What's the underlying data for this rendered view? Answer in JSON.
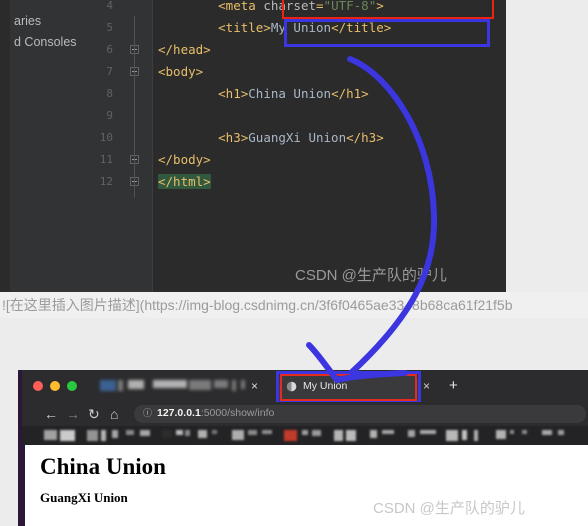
{
  "ide": {
    "sidebar": {
      "items": [
        {
          "label": "aries"
        },
        {
          "label": "d Consoles"
        }
      ]
    },
    "editor": {
      "lines": [
        {
          "number": "4",
          "indent": 8,
          "tokens": [
            {
              "text": "<meta",
              "cls": "tag"
            },
            {
              "text": " charset",
              "cls": "attr"
            },
            {
              "text": "=",
              "cls": "tag"
            },
            {
              "text": "\"UTF-8\"",
              "cls": "str"
            },
            {
              "text": ">",
              "cls": "tag"
            }
          ]
        },
        {
          "number": "5",
          "indent": 8,
          "tokens": [
            {
              "text": "<title>",
              "cls": "tag"
            },
            {
              "text": "My Union",
              "cls": "txt"
            },
            {
              "text": "</title>",
              "cls": "tag"
            }
          ]
        },
        {
          "number": "6",
          "indent": 0,
          "fold": true,
          "tokens": [
            {
              "text": "</head>",
              "cls": "tag"
            }
          ]
        },
        {
          "number": "7",
          "indent": 0,
          "fold": true,
          "tokens": [
            {
              "text": "<body>",
              "cls": "tag"
            }
          ]
        },
        {
          "number": "8",
          "indent": 8,
          "tokens": [
            {
              "text": "<h1>",
              "cls": "tag"
            },
            {
              "text": "China Union",
              "cls": "txt"
            },
            {
              "text": "</h1>",
              "cls": "tag"
            }
          ]
        },
        {
          "number": "9",
          "indent": 0,
          "tokens": []
        },
        {
          "number": "10",
          "indent": 8,
          "tokens": [
            {
              "text": "<h3>",
              "cls": "tag"
            },
            {
              "text": "GuangXi Union",
              "cls": "txt"
            },
            {
              "text": "</h3>",
              "cls": "tag"
            }
          ]
        },
        {
          "number": "11",
          "indent": 0,
          "fold": true,
          "tokens": [
            {
              "text": "</body>",
              "cls": "tag"
            }
          ]
        },
        {
          "number": "12",
          "indent": 0,
          "fold": true,
          "tokens": [
            {
              "text": "</html>",
              "cls": "tag hl-green"
            }
          ]
        }
      ]
    },
    "watermark": "CSDN @生产队的驴儿"
  },
  "annotations": {
    "red_box_label": "meta-charset-line-highlight",
    "blue_box_label": "title-line-highlight",
    "arrow_color": "#3b36e0",
    "red_color": "#ee2211",
    "blue_color": "#3b36e0"
  },
  "markdown": {
    "text": "![在这里插入图片描述](https://img-blog.csdnimg.cn/3f6f0465ae3348b68ca61f21f5b"
  },
  "browser": {
    "window_controls": [
      {
        "name": "close",
        "color": "#ff5f57"
      },
      {
        "name": "minimize",
        "color": "#febc2e"
      },
      {
        "name": "maximize",
        "color": "#28c840"
      }
    ],
    "blurred_tab_close": "×",
    "active_tab": {
      "title": "My Union",
      "favicon": "globe-icon",
      "close": "×"
    },
    "new_tab": "+",
    "nav": {
      "back": "←",
      "forward": "→",
      "reload": "↻",
      "home": "⌂"
    },
    "omnibox": {
      "info_icon": "ⓘ",
      "host": "127.0.0.1",
      "rest": ":5000/show/info"
    },
    "content": {
      "h1": "China Union",
      "h3": "GuangXi Union"
    },
    "watermark": "CSDN @生产队的驴儿"
  }
}
